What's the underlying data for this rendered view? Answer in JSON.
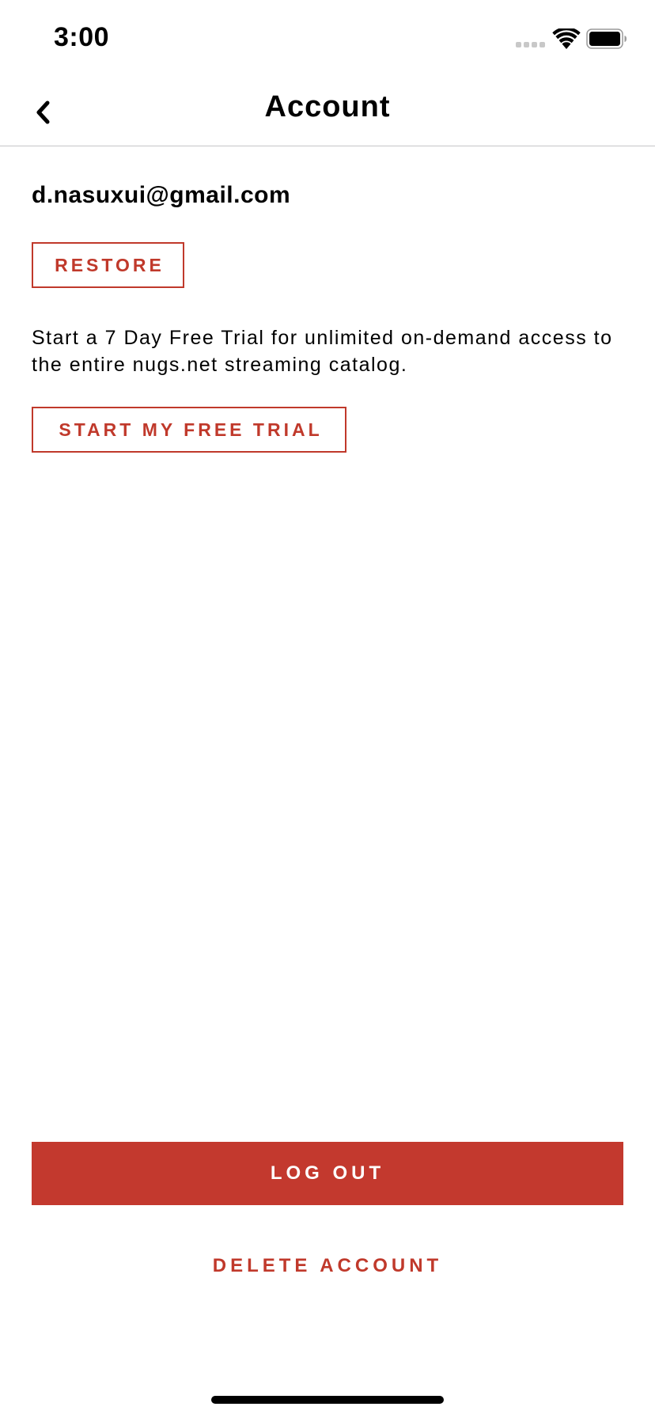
{
  "status_bar": {
    "time": "3:00"
  },
  "header": {
    "title": "Account",
    "back_icon": "chevron-left-icon"
  },
  "account": {
    "email": "d.nasuxui@gmail.com",
    "restore_label": "RESTORE",
    "trial_description": "Start a 7 Day Free Trial for unlimited on-demand access to the entire nugs.net streaming catalog.",
    "trial_button_label": "START MY FREE TRIAL"
  },
  "footer": {
    "logout_label": "LOG OUT",
    "delete_label": "DELETE ACCOUNT"
  },
  "colors": {
    "accent": "#c3392e",
    "text": "#000000",
    "background": "#ffffff"
  }
}
